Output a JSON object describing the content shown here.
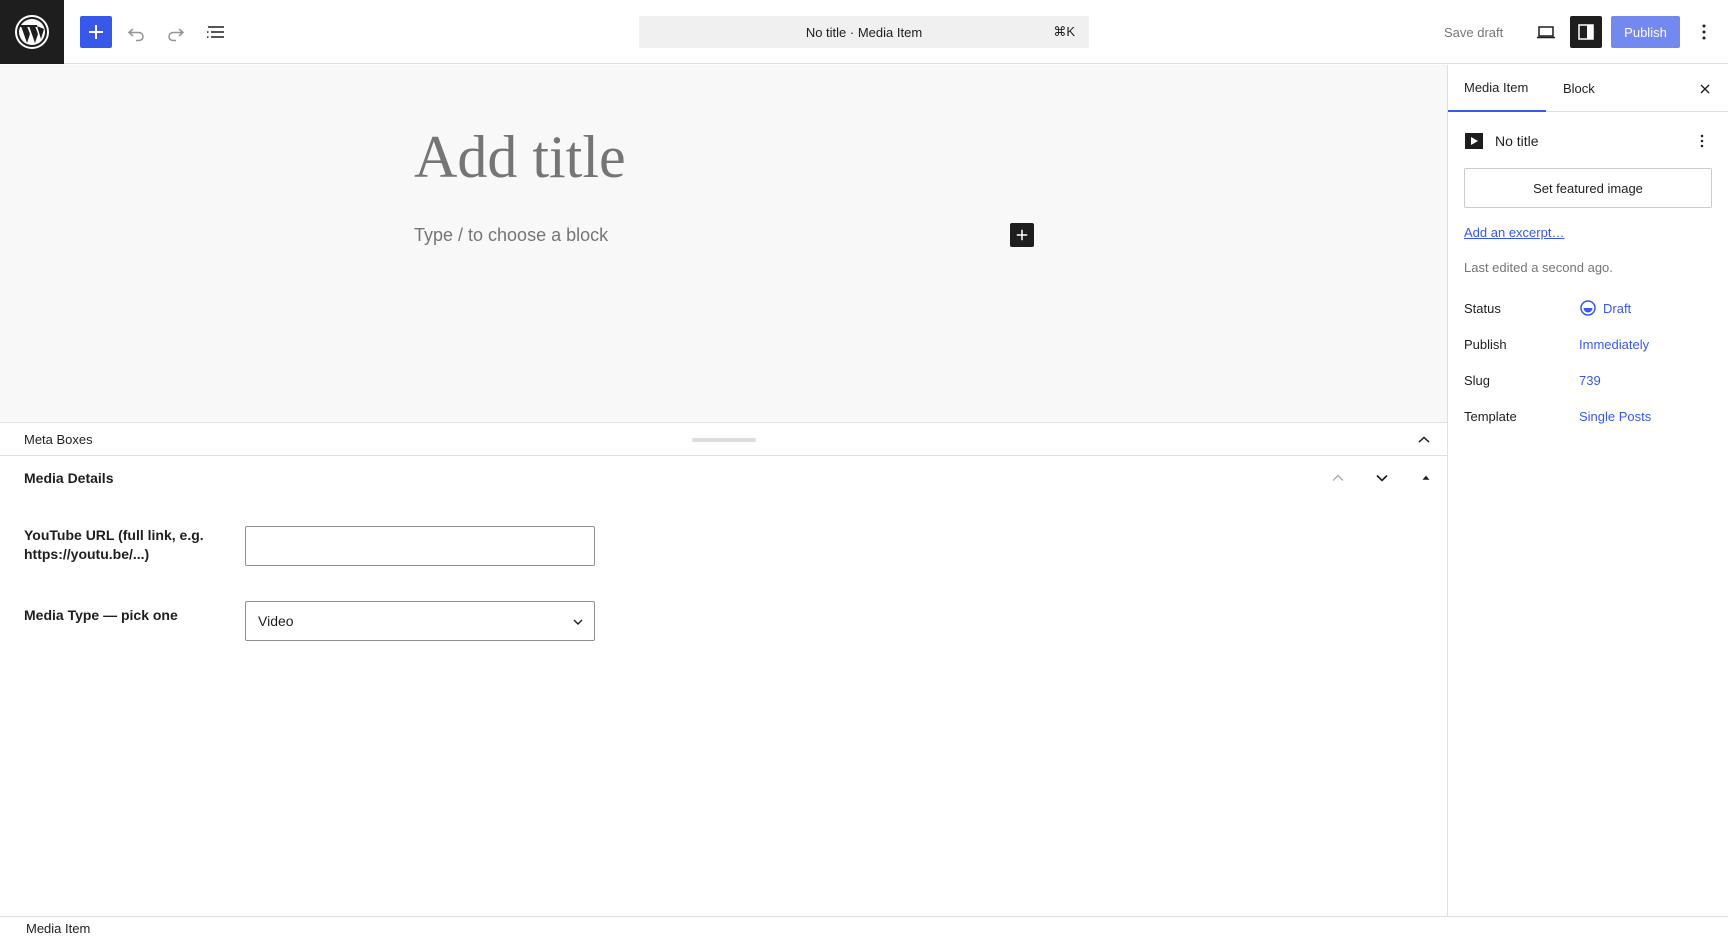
{
  "header": {
    "command_center": "No title · Media Item",
    "shortcut": "⌘K",
    "save_draft": "Save draft",
    "publish": "Publish"
  },
  "editor": {
    "title_placeholder": "Add title",
    "block_placeholder": "Type / to choose a block"
  },
  "meta": {
    "panel_title": "Meta Boxes",
    "box_title": "Media Details",
    "url_label": "YouTube URL (full link, e.g. https://youtu.be/...)",
    "url_value": "",
    "type_label": "Media Type — pick one",
    "type_value": "Video"
  },
  "footer": {
    "breadcrumb": "Media Item"
  },
  "sidebar": {
    "tabs": [
      {
        "label": "Media Item",
        "active": true
      },
      {
        "label": "Block",
        "active": false
      }
    ],
    "post_title": "No title",
    "featured_image": "Set featured image",
    "excerpt": "Add an excerpt…",
    "last_edited": "Last edited a second ago.",
    "properties": {
      "status_label": "Status",
      "status_value": "Draft",
      "publish_label": "Publish",
      "publish_value": "Immediately",
      "slug_label": "Slug",
      "slug_value": "739",
      "template_label": "Template",
      "template_value": "Single Posts"
    }
  },
  "colors": {
    "accent": "#3858e9",
    "dark": "#1e1e1e",
    "muted": "#757575",
    "canvas": "#f8f8f8"
  },
  "icons": [
    "wordpress-logo-icon",
    "plus-icon",
    "undo-icon",
    "redo-icon",
    "list-view-icon",
    "desktop-preview-icon",
    "sidebar-settings-icon",
    "more-vertical-icon",
    "close-icon",
    "chevron-up-icon",
    "chevron-down-icon",
    "triangle-up-icon",
    "video-icon",
    "draft-status-icon"
  ]
}
